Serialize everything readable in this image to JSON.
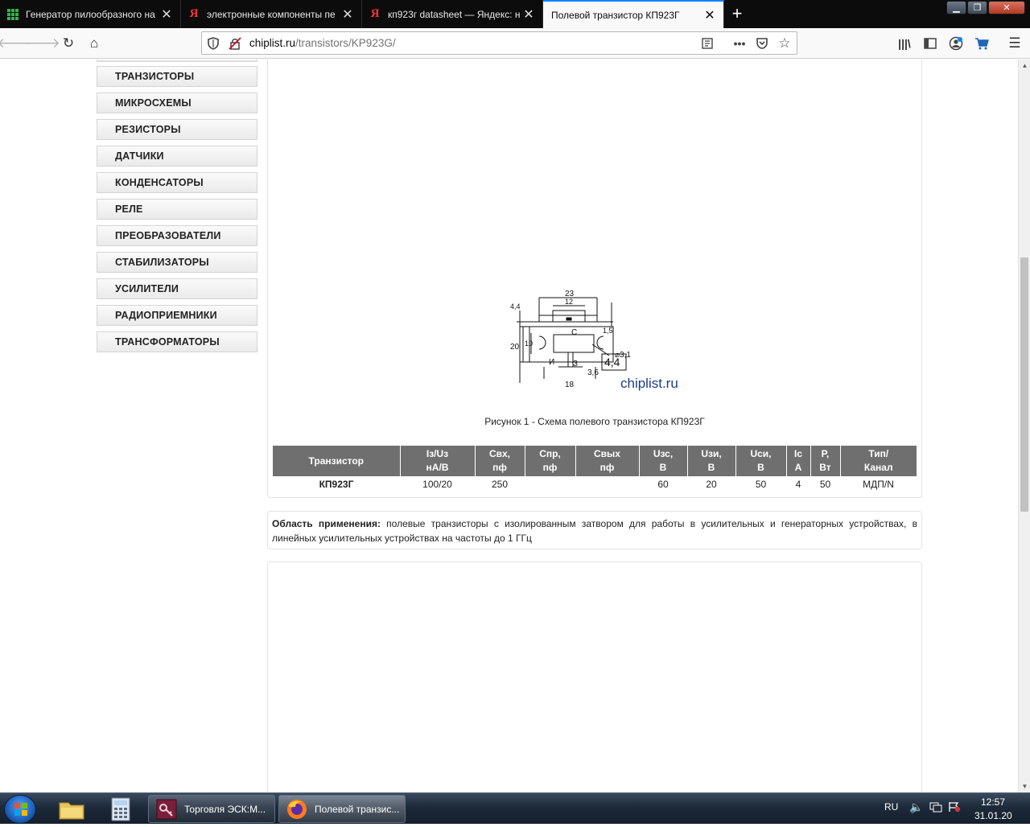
{
  "browser": {
    "tabs": [
      {
        "title": "Генератор пилообразного на",
        "icon": "grid-favicon-icon",
        "active": false
      },
      {
        "title": "электронные компоненты пе",
        "icon": "yandex-icon",
        "active": false
      },
      {
        "title": "кп923г datasheet — Яндекс: на",
        "icon": "yandex-icon",
        "active": false
      },
      {
        "title": "Полевой транзистор КП923Г",
        "icon": "none",
        "active": true
      }
    ],
    "new_tab": "+",
    "url_host": "chiplist.ru",
    "url_path": "/transistors/KP923G/"
  },
  "sidebar": {
    "items": [
      {
        "label": "ТРАНЗИСТОРЫ"
      },
      {
        "label": "МИКРОСХЕМЫ"
      },
      {
        "label": "РЕЗИСТОРЫ"
      },
      {
        "label": "ДАТЧИКИ"
      },
      {
        "label": "КОНДЕНСАТОРЫ"
      },
      {
        "label": "РЕЛЕ"
      },
      {
        "label": "ПРЕОБРАЗОВАТЕЛИ"
      },
      {
        "label": "СТАБИЛИЗАТОРЫ"
      },
      {
        "label": "УСИЛИТЕЛИ"
      },
      {
        "label": "РАДИОПРИЕМНИКИ"
      },
      {
        "label": "ТРАНСФОРМАТОРЫ"
      }
    ]
  },
  "drawing": {
    "dims": {
      "d_23": "23",
      "d_12": "12",
      "d_44_boxed": "4,4",
      "d_4_4": "4,4",
      "d_20": "20",
      "d_10": "10",
      "d_1_5": "1,5",
      "d_hole": "⌀3,1",
      "d_3_6": "3,6",
      "d_18": "18"
    },
    "pins": {
      "drain": "С",
      "source": "И",
      "gate": "З"
    },
    "watermark": "chiplist.ru"
  },
  "figure_caption": "Рисунок 1 - Схема полевого транзистора КП923Г",
  "table": {
    "headers": [
      [
        "Транзистор",
        ""
      ],
      [
        "Iз/Uз",
        "нА/В"
      ],
      [
        "Свх,",
        "пф"
      ],
      [
        "Спр,",
        "пф"
      ],
      [
        "Свых",
        "пф"
      ],
      [
        "Uзс,",
        "В"
      ],
      [
        "Uзи,",
        "В"
      ],
      [
        "Uси,",
        "В"
      ],
      [
        "Iс",
        "А"
      ],
      [
        "P,",
        "Вт"
      ],
      [
        "Тип/",
        "Канал"
      ]
    ],
    "rows": [
      [
        "КП923Г",
        "100/20",
        "250",
        "",
        "",
        "60",
        "20",
        "50",
        "4",
        "50",
        "МДП/N"
      ]
    ]
  },
  "application": {
    "label": "Область применения:",
    "text": " полевые транзисторы с изолированным затвором для работы в усилительных и генераторных устройствах, в линейных усилительных устройствах на частоты до 1 ГГц"
  },
  "taskbar": {
    "tasks": [
      {
        "label": "Торговля ЭСК:М...",
        "icon": "key-app-icon",
        "active": false
      },
      {
        "label": "Полевой транзис...",
        "icon": "firefox-icon",
        "active": true
      }
    ],
    "lang": "RU",
    "time": "12:57",
    "date": "31.01.20"
  }
}
